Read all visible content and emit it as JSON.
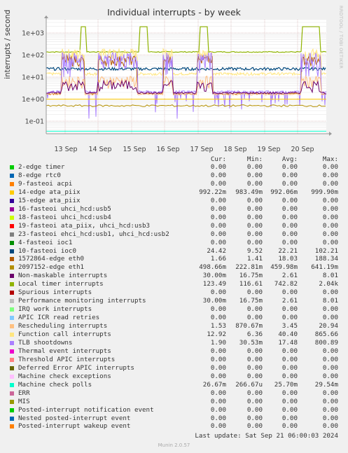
{
  "title": "Individual interrupts - by week",
  "side_label": "RRDTOOL / TOBI OETIKER",
  "ylabel": "interrupts / second",
  "columns": [
    "Cur:",
    "Min:",
    "Avg:",
    "Max:"
  ],
  "footer": "Last update: Sat Sep 21 06:00:03 2024",
  "munin": "Munin 2.0.57",
  "chart_data": {
    "type": "line",
    "title": "Individual interrupts - by week",
    "ylabel": "interrupts / second",
    "yscale": "log",
    "ylim": [
      0.03,
      2500
    ],
    "yticks": [
      "1e+03",
      "1e+02",
      "1e+01",
      "1e+00",
      "1e-01"
    ],
    "xticks": [
      "13 Sep",
      "14 Sep",
      "15 Sep",
      "16 Sep",
      "17 Sep",
      "18 Sep",
      "19 Sep",
      "20 Sep"
    ],
    "grid": true,
    "series": [
      {
        "name": "2-edge      timer",
        "color": "#00cc00",
        "cur": "0.00",
        "min": "0.00",
        "avg": "0.00",
        "max": "0.00"
      },
      {
        "name": "8-edge      rtc0",
        "color": "#0066b3",
        "cur": "0.00",
        "min": "0.00",
        "avg": "0.00",
        "max": "0.00"
      },
      {
        "name": "9-fasteoi   acpi",
        "color": "#ff8000",
        "cur": "0.00",
        "min": "0.00",
        "avg": "0.00",
        "max": "0.00"
      },
      {
        "name": "14-edge      ata_piix",
        "color": "#ffcc00",
        "cur": "992.22m",
        "min": "983.49m",
        "avg": "992.06m",
        "max": "999.90m"
      },
      {
        "name": "15-edge      ata_piix",
        "color": "#330099",
        "cur": "0.00",
        "min": "0.00",
        "avg": "0.00",
        "max": "0.00"
      },
      {
        "name": "16-fasteoi   uhci_hcd:usb5",
        "color": "#990099",
        "cur": "0.00",
        "min": "0.00",
        "avg": "0.00",
        "max": "0.00"
      },
      {
        "name": "18-fasteoi   uhci_hcd:usb4",
        "color": "#ccff00",
        "cur": "0.00",
        "min": "0.00",
        "avg": "0.00",
        "max": "0.00"
      },
      {
        "name": "19-fasteoi   ata_piix, uhci_hcd:usb3",
        "color": "#ff0000",
        "cur": "0.00",
        "min": "0.00",
        "avg": "0.00",
        "max": "0.00"
      },
      {
        "name": "23-fasteoi   ehci_hcd:usb1, uhci_hcd:usb2",
        "color": "#808080",
        "cur": "0.00",
        "min": "0.00",
        "avg": "0.00",
        "max": "0.00"
      },
      {
        "name": "4-fasteoi   ioc1",
        "color": "#008f00",
        "cur": "0.00",
        "min": "0.00",
        "avg": "0.00",
        "max": "0.00"
      },
      {
        "name": "10-fasteoi   ioc0",
        "color": "#00487d",
        "cur": "24.42",
        "min": "9.52",
        "avg": "22.21",
        "max": "102.21"
      },
      {
        "name": "1572864-edge      eth0",
        "color": "#b35a00",
        "cur": "1.66",
        "min": "1.41",
        "avg": "18.03",
        "max": "188.34"
      },
      {
        "name": "2097152-edge      eth1",
        "color": "#b38f00",
        "cur": "498.66m",
        "min": "222.81m",
        "avg": "459.98m",
        "max": "641.19m"
      },
      {
        "name": "Non-maskable interrupts",
        "color": "#6b006b",
        "cur": "30.00m",
        "min": "16.75m",
        "avg": "2.61",
        "max": "8.01"
      },
      {
        "name": "Local timer interrupts",
        "color": "#8fb300",
        "cur": "123.49",
        "min": "116.61",
        "avg": "742.82",
        "max": "2.04k"
      },
      {
        "name": "Spurious interrupts",
        "color": "#b30000",
        "cur": "0.00",
        "min": "0.00",
        "avg": "0.00",
        "max": "0.00"
      },
      {
        "name": "Performance monitoring interrupts",
        "color": "#bebebe",
        "cur": "30.00m",
        "min": "16.75m",
        "avg": "2.61",
        "max": "8.01"
      },
      {
        "name": "IRQ work interrupts",
        "color": "#80ff80",
        "cur": "0.00",
        "min": "0.00",
        "avg": "0.00",
        "max": "0.00"
      },
      {
        "name": "APIC ICR read retries",
        "color": "#80c9ff",
        "cur": "0.00",
        "min": "0.00",
        "avg": "0.00",
        "max": "0.00"
      },
      {
        "name": "Rescheduling interrupts",
        "color": "#ffc080",
        "cur": "1.53",
        "min": "870.67m",
        "avg": "3.45",
        "max": "20.94"
      },
      {
        "name": "Function call interrupts",
        "color": "#ffe680",
        "cur": "12.92",
        "min": "6.36",
        "avg": "40.40",
        "max": "865.66"
      },
      {
        "name": "TLB shootdowns",
        "color": "#aa80ff",
        "cur": "1.90",
        "min": "30.53m",
        "avg": "17.48",
        "max": "800.89"
      },
      {
        "name": "Thermal event interrupts",
        "color": "#ee00cc",
        "cur": "0.00",
        "min": "0.00",
        "avg": "0.00",
        "max": "0.00"
      },
      {
        "name": "Threshold APIC interrupts",
        "color": "#ff8080",
        "cur": "0.00",
        "min": "0.00",
        "avg": "0.00",
        "max": "0.00"
      },
      {
        "name": "Deferred Error APIC interrupts",
        "color": "#666600",
        "cur": "0.00",
        "min": "0.00",
        "avg": "0.00",
        "max": "0.00"
      },
      {
        "name": "Machine check exceptions",
        "color": "#ffbfff",
        "cur": "0.00",
        "min": "0.00",
        "avg": "0.00",
        "max": "0.00"
      },
      {
        "name": "Machine check polls",
        "color": "#00ffcc",
        "cur": "26.67m",
        "min": "266.67u",
        "avg": "25.70m",
        "max": "29.54m"
      },
      {
        "name": "ERR",
        "color": "#cc6699",
        "cur": "0.00",
        "min": "0.00",
        "avg": "0.00",
        "max": "0.00"
      },
      {
        "name": "MIS",
        "color": "#999900",
        "cur": "0.00",
        "min": "0.00",
        "avg": "0.00",
        "max": "0.00"
      },
      {
        "name": "Posted-interrupt notification event",
        "color": "#00cc00",
        "cur": "0.00",
        "min": "0.00",
        "avg": "0.00",
        "max": "0.00"
      },
      {
        "name": "Nested posted-interrupt event",
        "color": "#0066b3",
        "cur": "0.00",
        "min": "0.00",
        "avg": "0.00",
        "max": "0.00"
      },
      {
        "name": "Posted-interrupt wakeup event",
        "color": "#ff8000",
        "cur": "0.00",
        "min": "0.00",
        "avg": "0.00",
        "max": "0.00"
      }
    ]
  }
}
